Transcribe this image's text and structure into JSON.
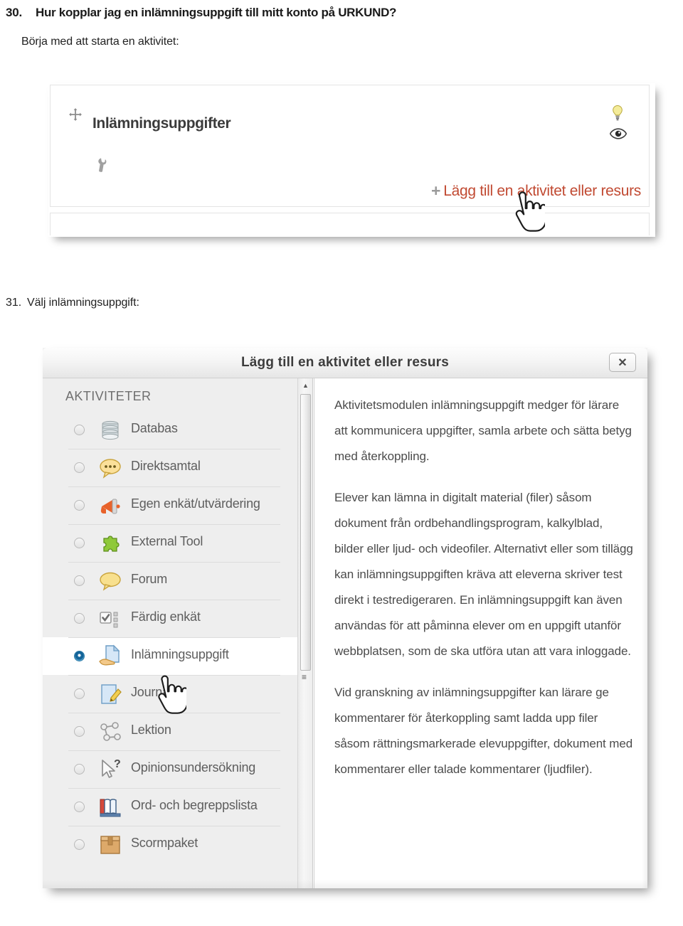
{
  "document": {
    "question_number": "30.",
    "question_text": "Hur kopplar jag en inlämningsuppgift till mitt konto på URKUND?",
    "intro_text": "Börja med att starta en aktivitet:",
    "step2_number": "31.",
    "step2_text": "Välj inlämningsuppgift:"
  },
  "screenshot1": {
    "section_title": "Inlämningsuppgifter",
    "add_activity_label": "Lägg till en aktivitet eller resurs",
    "plus_glyph": "+",
    "move_glyph": "✥",
    "wrench_glyph": "⚲",
    "bulb_glyph": "●",
    "link_color": "#c14a32"
  },
  "dialog": {
    "title": "Lägg till en aktivitet eller resurs",
    "close_label": "✕",
    "pane_heading": "AKTIVITETER",
    "activities": [
      {
        "label": "Databas",
        "icon": "database-icon",
        "selected": false
      },
      {
        "label": "Direktsamtal",
        "icon": "chat-bubble-icon",
        "selected": false
      },
      {
        "label": "Egen enkät/utvärdering",
        "icon": "megaphone-icon",
        "selected": false
      },
      {
        "label": "External Tool",
        "icon": "puzzle-piece-icon",
        "selected": false
      },
      {
        "label": "Forum",
        "icon": "speech-bubble-icon",
        "selected": false
      },
      {
        "label": "Färdig enkät",
        "icon": "checklist-icon",
        "selected": false
      },
      {
        "label": "Inlämningsuppgift",
        "icon": "assignment-hand-icon",
        "selected": true
      },
      {
        "label": "Journal",
        "icon": "document-pencil-icon",
        "selected": false
      },
      {
        "label": "Lektion",
        "icon": "node-graph-icon",
        "selected": false
      },
      {
        "label": "Opinionsundersökning",
        "icon": "cursor-question-icon",
        "selected": false
      },
      {
        "label": "Ord- och begreppslista",
        "icon": "open-book-icon",
        "selected": false
      },
      {
        "label": "Scormpaket",
        "icon": "package-box-icon",
        "selected": false
      }
    ],
    "description_paragraphs": [
      "Aktivitetsmodulen inlämningsuppgift medger för lärare att kommunicera uppgifter, samla arbete och sätta betyg med återkoppling.",
      "Elever kan lämna in digitalt material (filer) såsom dokument från ordbehandlingsprogram, kalkylblad, bilder eller ljud- och videofiler. Alternativt eller som tillägg kan inlämningsuppgiften kräva att eleverna skriver test direkt i testredigeraren. En inlämningsuppgift kan även användas för att påminna elever om en uppgift utanför webbplatsen, som de ska utföra utan att vara inloggade.",
      "Vid granskning av inlämningsuppgifter kan lärare ge kommentarer för återkoppling samt ladda upp filer såsom rättningsmarkerade elevuppgifter, dokument med kommentarer eller talade kommentarer (ljudfiler)."
    ],
    "scrollbar_arrow_up": "▲",
    "scrollbar_grip": "≡"
  }
}
